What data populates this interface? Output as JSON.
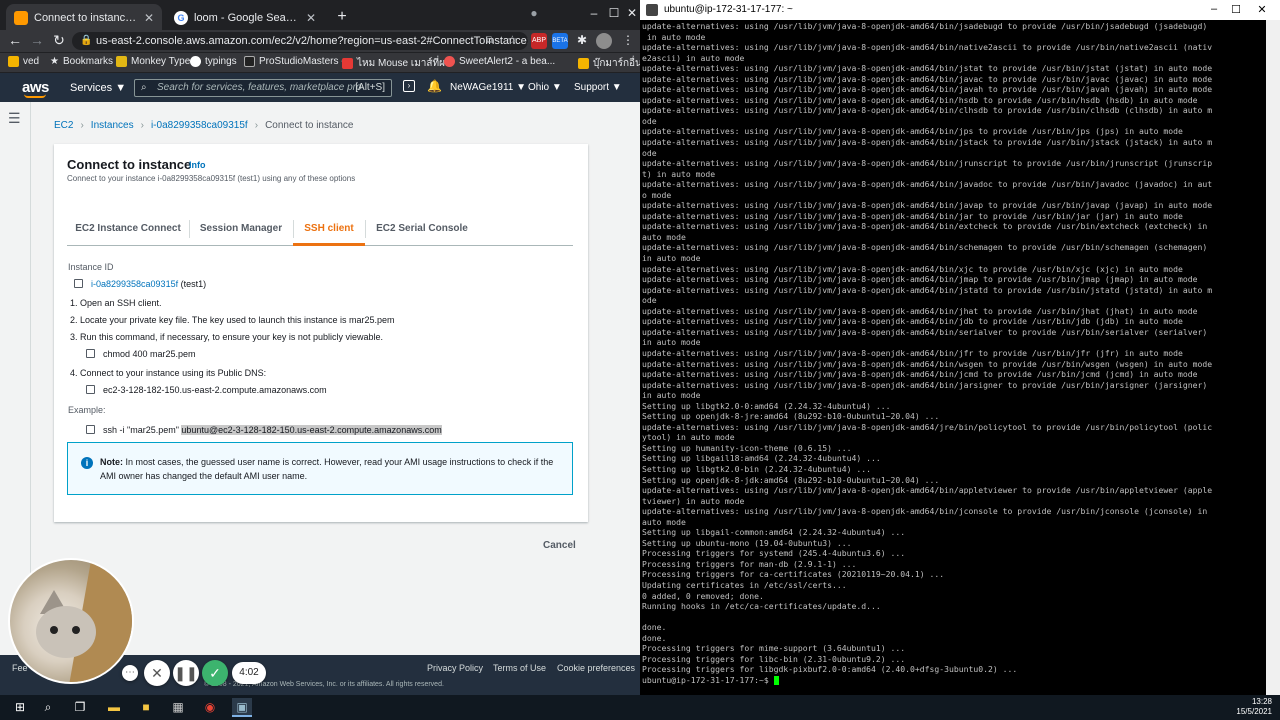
{
  "browser": {
    "tabs": [
      {
        "title": "Connect to instance | EC2 Management",
        "active": true
      },
      {
        "title": "loom - Google Search",
        "active": false
      }
    ],
    "url": "us-east-2.console.aws.amazon.com/ec2/v2/home?region=us-east-2#ConnectToInstance:in...",
    "bookmarks": [
      "ved",
      "Bookmarks",
      "Monkey Type",
      "typings",
      "ProStudioMasters -...",
      "ไหม Mouse เมาส์ที่ผ...",
      "SweetAlert2 - a bea...",
      "บุ๊กมาร์กอื่นๆ"
    ],
    "beta_badge": "BETA"
  },
  "aws_nav": {
    "logo": "aws",
    "services": "Services ▼",
    "search_placeholder": "Search for services, features, marketplace pro",
    "search_shortcut": "[Alt+S]",
    "account": "NeWAGe1911 ▼",
    "region": "Ohio ▼",
    "support": "Support ▼"
  },
  "breadcrumb": [
    "EC2",
    "Instances",
    "i-0a8299358ca09315f",
    "Connect to instance"
  ],
  "panel": {
    "title": "Connect to instance",
    "info": "Info",
    "subtitle": "Connect to your instance i-0a8299358ca09315f (test1) using any of these options",
    "tabs": [
      "EC2 Instance Connect",
      "Session Manager",
      "SSH client",
      "EC2 Serial Console"
    ],
    "selected_tab": "SSH client",
    "instance_id_label": "Instance ID",
    "instance_id": "i-0a8299358ca09315f",
    "instance_name": "(test1)",
    "step1": "1. Open an SSH client.",
    "step2": "2. Locate your private key file. The key used to launch this instance is mar25.pem",
    "step3": "3. Run this command, if necessary, to ensure your key is not publicly viewable.",
    "chmod_cmd": "chmod 400 mar25.pem",
    "step4": "4. Connect to your instance using its Public DNS:",
    "public_dns": "ec2-3-128-182-150.us-east-2.compute.amazonaws.com",
    "example_label": "Example:",
    "example_prefix": "ssh -i \"mar25.pem\" ",
    "example_host": "ubuntu@ec2-3-128-182-150.us-east-2.compute.amazonaws.com",
    "note_bold": "Note:",
    "note_text": " In most cases, the guessed user name is correct. However, read your AMI usage instructions to check if the AMI owner has changed the default AMI user name.",
    "cancel": "Cancel"
  },
  "footer": {
    "feedback": "Fee",
    "privacy": "Privacy Policy",
    "terms": "Terms of Use",
    "cookies": "Cookie preferences",
    "copyright": "© 2008 - 2021, Amazon Web Services, Inc. or its affiliates. All rights reserved."
  },
  "recorder": {
    "time": "4:02"
  },
  "terminal": {
    "title": "ubuntu@ip-172-31-17-177: ~",
    "lines": [
      "update-alternatives: using /usr/lib/jvm/java-8-openjdk-amd64/bin/jsadebugd to provide /usr/bin/jsadebugd (jsadebugd)",
      " in auto mode",
      "update-alternatives: using /usr/lib/jvm/java-8-openjdk-amd64/bin/native2ascii to provide /usr/bin/native2ascii (nativ",
      "e2ascii) in auto mode",
      "update-alternatives: using /usr/lib/jvm/java-8-openjdk-amd64/bin/jstat to provide /usr/bin/jstat (jstat) in auto mode",
      "update-alternatives: using /usr/lib/jvm/java-8-openjdk-amd64/bin/javac to provide /usr/bin/javac (javac) in auto mode",
      "update-alternatives: using /usr/lib/jvm/java-8-openjdk-amd64/bin/javah to provide /usr/bin/javah (javah) in auto mode",
      "update-alternatives: using /usr/lib/jvm/java-8-openjdk-amd64/bin/hsdb to provide /usr/bin/hsdb (hsdb) in auto mode",
      "update-alternatives: using /usr/lib/jvm/java-8-openjdk-amd64/bin/clhsdb to provide /usr/bin/clhsdb (clhsdb) in auto m",
      "ode",
      "update-alternatives: using /usr/lib/jvm/java-8-openjdk-amd64/bin/jps to provide /usr/bin/jps (jps) in auto mode",
      "update-alternatives: using /usr/lib/jvm/java-8-openjdk-amd64/bin/jstack to provide /usr/bin/jstack (jstack) in auto m",
      "ode",
      "update-alternatives: using /usr/lib/jvm/java-8-openjdk-amd64/bin/jrunscript to provide /usr/bin/jrunscript (jrunscrip",
      "t) in auto mode",
      "update-alternatives: using /usr/lib/jvm/java-8-openjdk-amd64/bin/javadoc to provide /usr/bin/javadoc (javadoc) in aut",
      "o mode",
      "update-alternatives: using /usr/lib/jvm/java-8-openjdk-amd64/bin/javap to provide /usr/bin/javap (javap) in auto mode",
      "update-alternatives: using /usr/lib/jvm/java-8-openjdk-amd64/bin/jar to provide /usr/bin/jar (jar) in auto mode",
      "update-alternatives: using /usr/lib/jvm/java-8-openjdk-amd64/bin/extcheck to provide /usr/bin/extcheck (extcheck) in",
      "auto mode",
      "update-alternatives: using /usr/lib/jvm/java-8-openjdk-amd64/bin/schemagen to provide /usr/bin/schemagen (schemagen)",
      "in auto mode",
      "update-alternatives: using /usr/lib/jvm/java-8-openjdk-amd64/bin/xjc to provide /usr/bin/xjc (xjc) in auto mode",
      "update-alternatives: using /usr/lib/jvm/java-8-openjdk-amd64/bin/jmap to provide /usr/bin/jmap (jmap) in auto mode",
      "update-alternatives: using /usr/lib/jvm/java-8-openjdk-amd64/bin/jstatd to provide /usr/bin/jstatd (jstatd) in auto m",
      "ode",
      "update-alternatives: using /usr/lib/jvm/java-8-openjdk-amd64/bin/jhat to provide /usr/bin/jhat (jhat) in auto mode",
      "update-alternatives: using /usr/lib/jvm/java-8-openjdk-amd64/bin/jdb to provide /usr/bin/jdb (jdb) in auto mode",
      "update-alternatives: using /usr/lib/jvm/java-8-openjdk-amd64/bin/serialver to provide /usr/bin/serialver (serialver)",
      "in auto mode",
      "update-alternatives: using /usr/lib/jvm/java-8-openjdk-amd64/bin/jfr to provide /usr/bin/jfr (jfr) in auto mode",
      "update-alternatives: using /usr/lib/jvm/java-8-openjdk-amd64/bin/wsgen to provide /usr/bin/wsgen (wsgen) in auto mode",
      "update-alternatives: using /usr/lib/jvm/java-8-openjdk-amd64/bin/jcmd to provide /usr/bin/jcmd (jcmd) in auto mode",
      "update-alternatives: using /usr/lib/jvm/java-8-openjdk-amd64/bin/jarsigner to provide /usr/bin/jarsigner (jarsigner)",
      "in auto mode",
      "Setting up libgtk2.0-0:amd64 (2.24.32-4ubuntu4) ...",
      "Setting up openjdk-8-jre:amd64 (8u292-b10-0ubuntu1~20.04) ...",
      "update-alternatives: using /usr/lib/jvm/java-8-openjdk-amd64/jre/bin/policytool to provide /usr/bin/policytool (polic",
      "ytool) in auto mode",
      "Setting up humanity-icon-theme (0.6.15) ...",
      "Setting up libgail18:amd64 (2.24.32-4ubuntu4) ...",
      "Setting up libgtk2.0-bin (2.24.32-4ubuntu4) ...",
      "Setting up openjdk-8-jdk:amd64 (8u292-b10-0ubuntu1~20.04) ...",
      "update-alternatives: using /usr/lib/jvm/java-8-openjdk-amd64/bin/appletviewer to provide /usr/bin/appletviewer (apple",
      "tviewer) in auto mode",
      "update-alternatives: using /usr/lib/jvm/java-8-openjdk-amd64/bin/jconsole to provide /usr/bin/jconsole (jconsole) in",
      "auto mode",
      "Setting up libgail-common:amd64 (2.24.32-4ubuntu4) ...",
      "Setting up ubuntu-mono (19.04-0ubuntu3) ...",
      "Processing triggers for systemd (245.4-4ubuntu3.6) ...",
      "Processing triggers for man-db (2.9.1-1) ...",
      "Processing triggers for ca-certificates (20210119~20.04.1) ...",
      "Updating certificates in /etc/ssl/certs...",
      "0 added, 0 removed; done.",
      "Running hooks in /etc/ca-certificates/update.d...",
      "",
      "done.",
      "done.",
      "Processing triggers for mime-support (3.64ubuntu1) ...",
      "Processing triggers for libc-bin (2.31-0ubuntu9.2) ...",
      "Processing triggers for libgdk-pixbuf2.0-0:amd64 (2.40.0+dfsg-3ubuntu0.2) ...",
      "ubuntu@ip-172-31-17-177:~$ "
    ]
  },
  "taskbar": {
    "time": "13:28",
    "date": "15/5/2021"
  }
}
